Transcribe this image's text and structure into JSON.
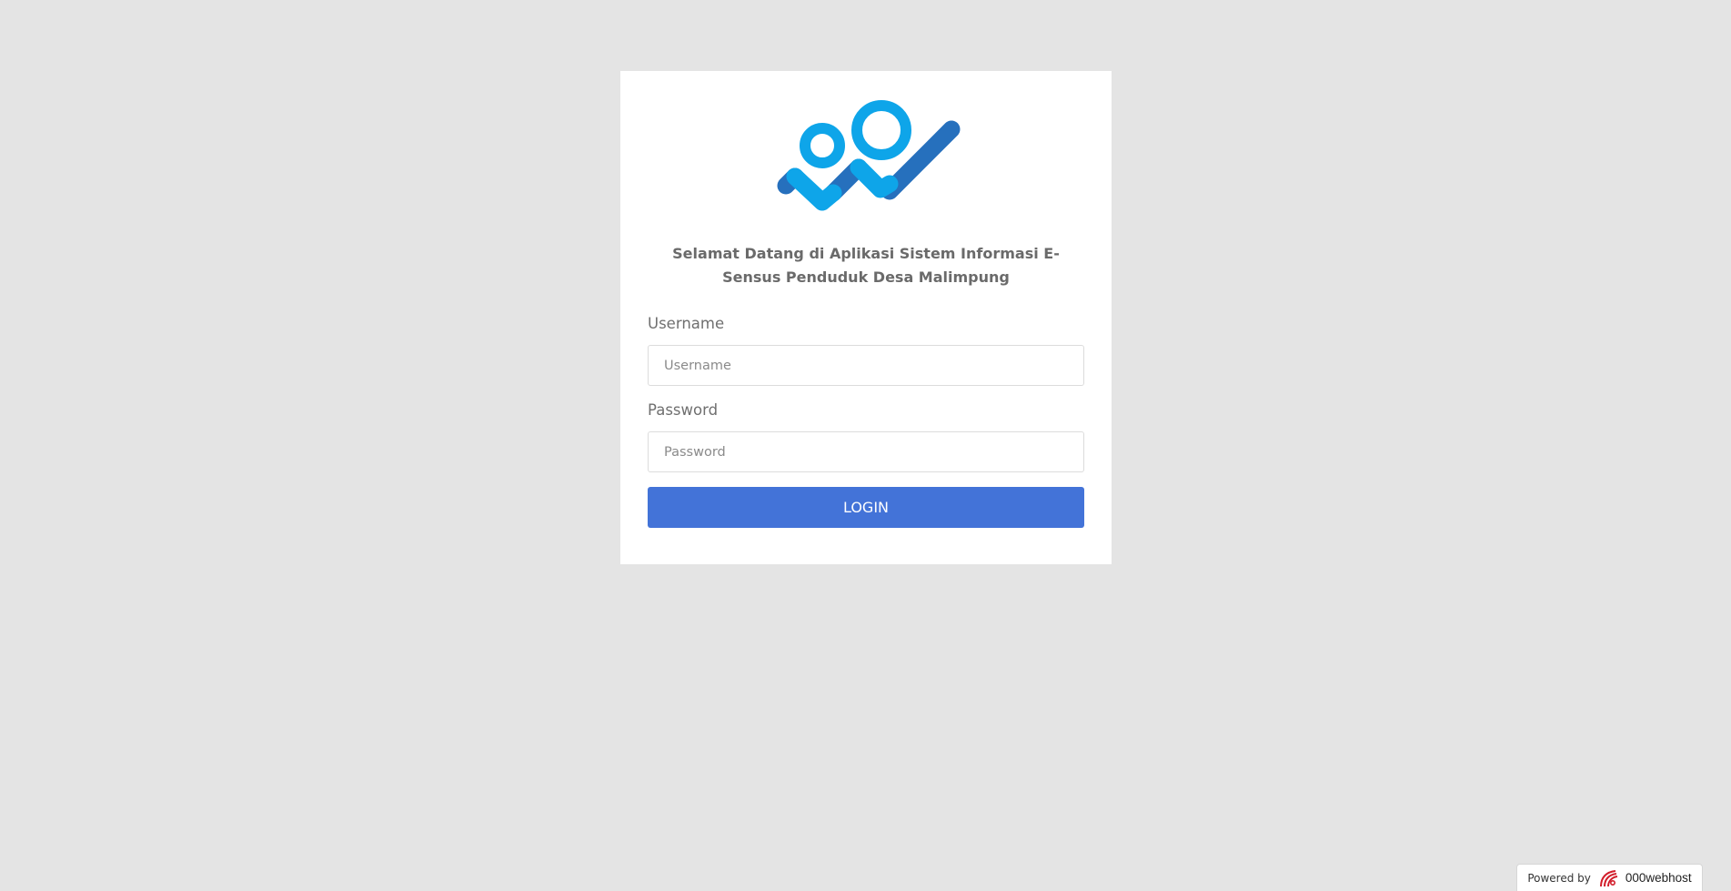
{
  "login": {
    "welcome_text": "Selamat Datang di Aplikasi Sistem Informasi E-Sensus Penduduk Desa Malimpung",
    "username": {
      "label": "Username",
      "placeholder": "Username",
      "value": ""
    },
    "password": {
      "label": "Password",
      "placeholder": "Password",
      "value": ""
    },
    "login_button": "LOGIN",
    "logo_icon": "people-chart-logo-icon"
  },
  "footer": {
    "powered_by": "Powered by",
    "brand": "000webhost",
    "brand_icon": "000webhost-logo-icon"
  },
  "colors": {
    "background": "#e4e4e4",
    "card": "#ffffff",
    "button": "#4373d8",
    "logo_light_blue": "#0ea5e9",
    "logo_dark_blue": "#2670bd"
  }
}
